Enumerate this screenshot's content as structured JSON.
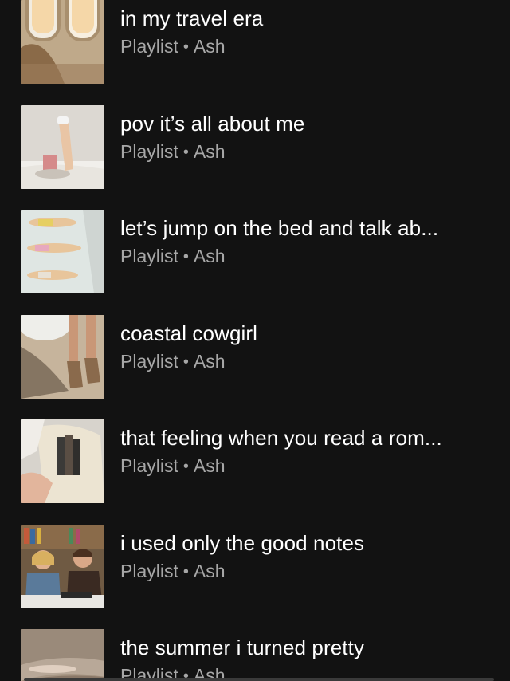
{
  "playlists": [
    {
      "title": "in my travel era",
      "type": "Playlist",
      "separator": "•",
      "owner": "Ash",
      "thumb_icon": "airplane-window-image"
    },
    {
      "title": "pov it’s all about me",
      "type": "Playlist",
      "separator": "•",
      "owner": "Ash",
      "thumb_icon": "legs-up-bed-image"
    },
    {
      "title": "let’s jump on the bed and talk ab...",
      "type": "Playlist",
      "separator": "•",
      "owner": "Ash",
      "thumb_icon": "girls-lying-bed-image"
    },
    {
      "title": "coastal cowgirl",
      "type": "Playlist",
      "separator": "•",
      "owner": "Ash",
      "thumb_icon": "beach-boots-image"
    },
    {
      "title": "that feeling when you read a rom...",
      "type": "Playlist",
      "separator": "•",
      "owner": "Ash",
      "thumb_icon": "books-in-bag-image"
    },
    {
      "title": "i used only the good notes",
      "type": "Playlist",
      "separator": "•",
      "owner": "Ash",
      "thumb_icon": "tv-scene-image"
    },
    {
      "title": "the summer i turned pretty",
      "type": "Playlist",
      "separator": "•",
      "owner": "Ash",
      "thumb_icon": "ocean-swim-image"
    }
  ],
  "colors": {
    "background": "#121212",
    "title": "#ffffff",
    "subtitle": "#a7a7a7"
  }
}
